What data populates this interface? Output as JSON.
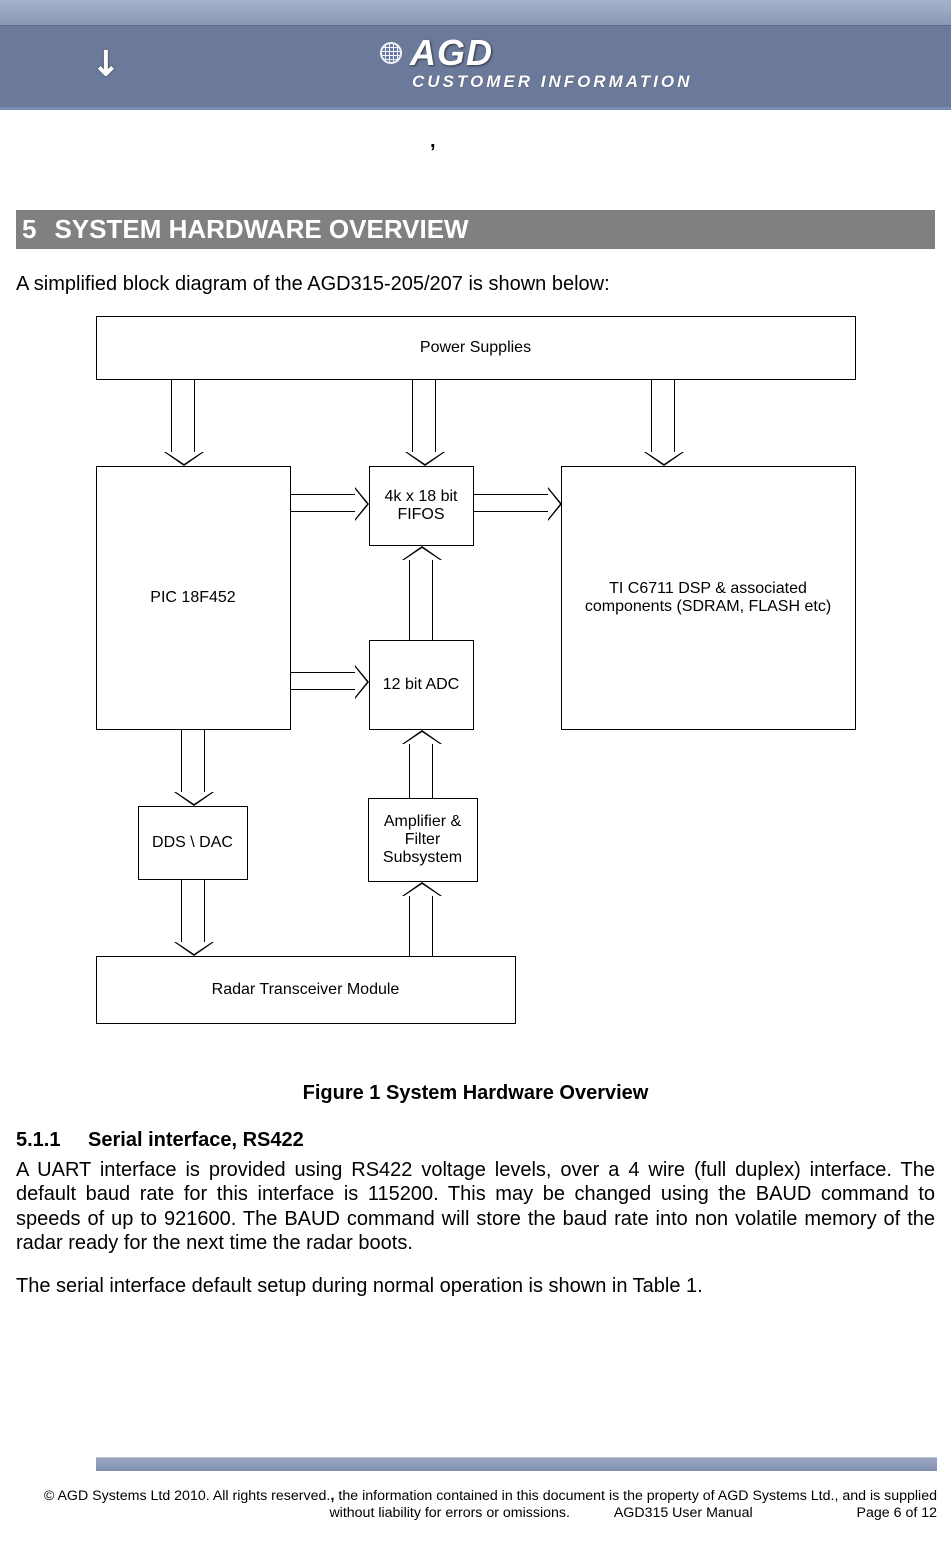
{
  "header": {
    "brand": "AGD",
    "subtitle": "CUSTOMER INFORMATION",
    "stray_comma": ","
  },
  "section": {
    "number": "5",
    "title": "SYSTEM HARDWARE OVERVIEW"
  },
  "intro": "A simplified block diagram of the AGD315-205/207 is shown below:",
  "diagram": {
    "power": "Power Supplies",
    "pic": "PIC 18F452",
    "fifo": "4k x 18 bit FIFOS",
    "adc": "12 bit ADC",
    "dsp": "TI C6711 DSP & associated components (SDRAM, FLASH etc)",
    "dds": "DDS \\ DAC",
    "amp": "Amplifier & Filter Subsystem",
    "radar": "Radar Transceiver Module"
  },
  "figure_caption": "Figure 1 System Hardware Overview",
  "subsection": {
    "number": "5.1.1",
    "title": "Serial interface, RS422"
  },
  "paragraph1": "A UART interface is provided using RS422 voltage levels, over a 4 wire (full duplex) interface. The default baud rate for this interface is 115200. This may be changed using the BAUD command to speeds of up to 921600. The BAUD command will store the baud rate into non volatile memory of the radar ready for the next time the radar boots.",
  "paragraph2": "The serial interface default setup during normal operation is shown in Table 1.",
  "footer": {
    "line1a": "© AGD Systems Ltd 2010. All rights reserved.",
    "comma": ",",
    "line1b": " the information contained in this document is the property of AGD Systems Ltd., and is supplied",
    "line2a": "without liability for errors or omissions.",
    "line2b": "AGD315 User Manual",
    "line2c": "Page 6 of 12"
  }
}
